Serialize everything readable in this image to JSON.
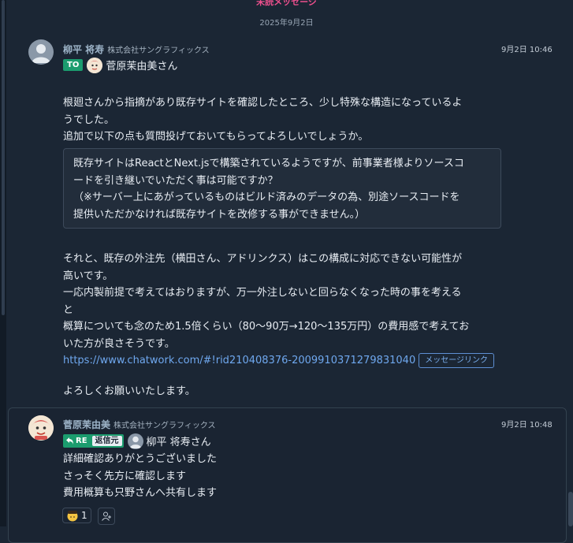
{
  "header": {
    "unread_label": "未読メッセージ",
    "date_separator": "2025年9月2日"
  },
  "messages": [
    {
      "sender": "柳平 将寿",
      "organization": "株式会社サングラフィックス",
      "time": "9月2日 10:46",
      "to_badge": "TO",
      "to_name": "菅原茉由美さん",
      "lines_1": [
        "根廻さんから指摘があり既存サイトを確認したところ、少し特殊な構造になっているよ",
        "うでした。",
        "追加で以下の点も質問投げておいてもらってよろしいでしょうか。"
      ],
      "quote_lines": [
        "既存サイトはReactとNext.jsで構築されているようですが、前事業者様よりソースコ",
        "ードを引き継いでいただく事は可能ですか？",
        "（※サーバー上にあがっているものはビルド済みのデータの為、別途ソースコードを",
        "提供いただかなければ既存サイトを改修する事ができません。）"
      ],
      "lines_2": [
        "それと、既存の外注先（横田さん、アドリンクス）はこの構成に対応できない可能性が",
        "高いです。",
        "一応内製前提で考えてはおりますが、万一外注しないと回らなくなった時の事を考える",
        "と",
        "概算についても念のため1.5倍くらい（80〜90万→120〜135万円）の費用感で考えてお",
        "いた方が良さそうです。"
      ],
      "link_url": "https://www.chatwork.com/#!rid210408376-2009910371279831040",
      "link_button": "メッセージリンク",
      "closing": "よろしくお願いいたします。"
    },
    {
      "sender": "菅原茉由美",
      "organization": "株式会社サングラフィックス",
      "time": "9月2日 10:48",
      "re_badge": "RE",
      "re_source": "返信元",
      "re_name": "柳平 将寿さん",
      "lines": [
        "詳細確認ありがとうございました",
        "さっそく先方に確認します",
        "費用概算も只野さんへ共有します"
      ],
      "reaction_count": "1"
    }
  ],
  "colors": {
    "background": "#1b2634",
    "badge_green": "#1b9c6e",
    "link_blue": "#6fa8ef",
    "unread_pink": "#ec4f8d"
  },
  "icons": {
    "reply": "reply-arrow-icon",
    "reaction": "bowing-face-icon",
    "add_reaction": "person-add-icon"
  }
}
